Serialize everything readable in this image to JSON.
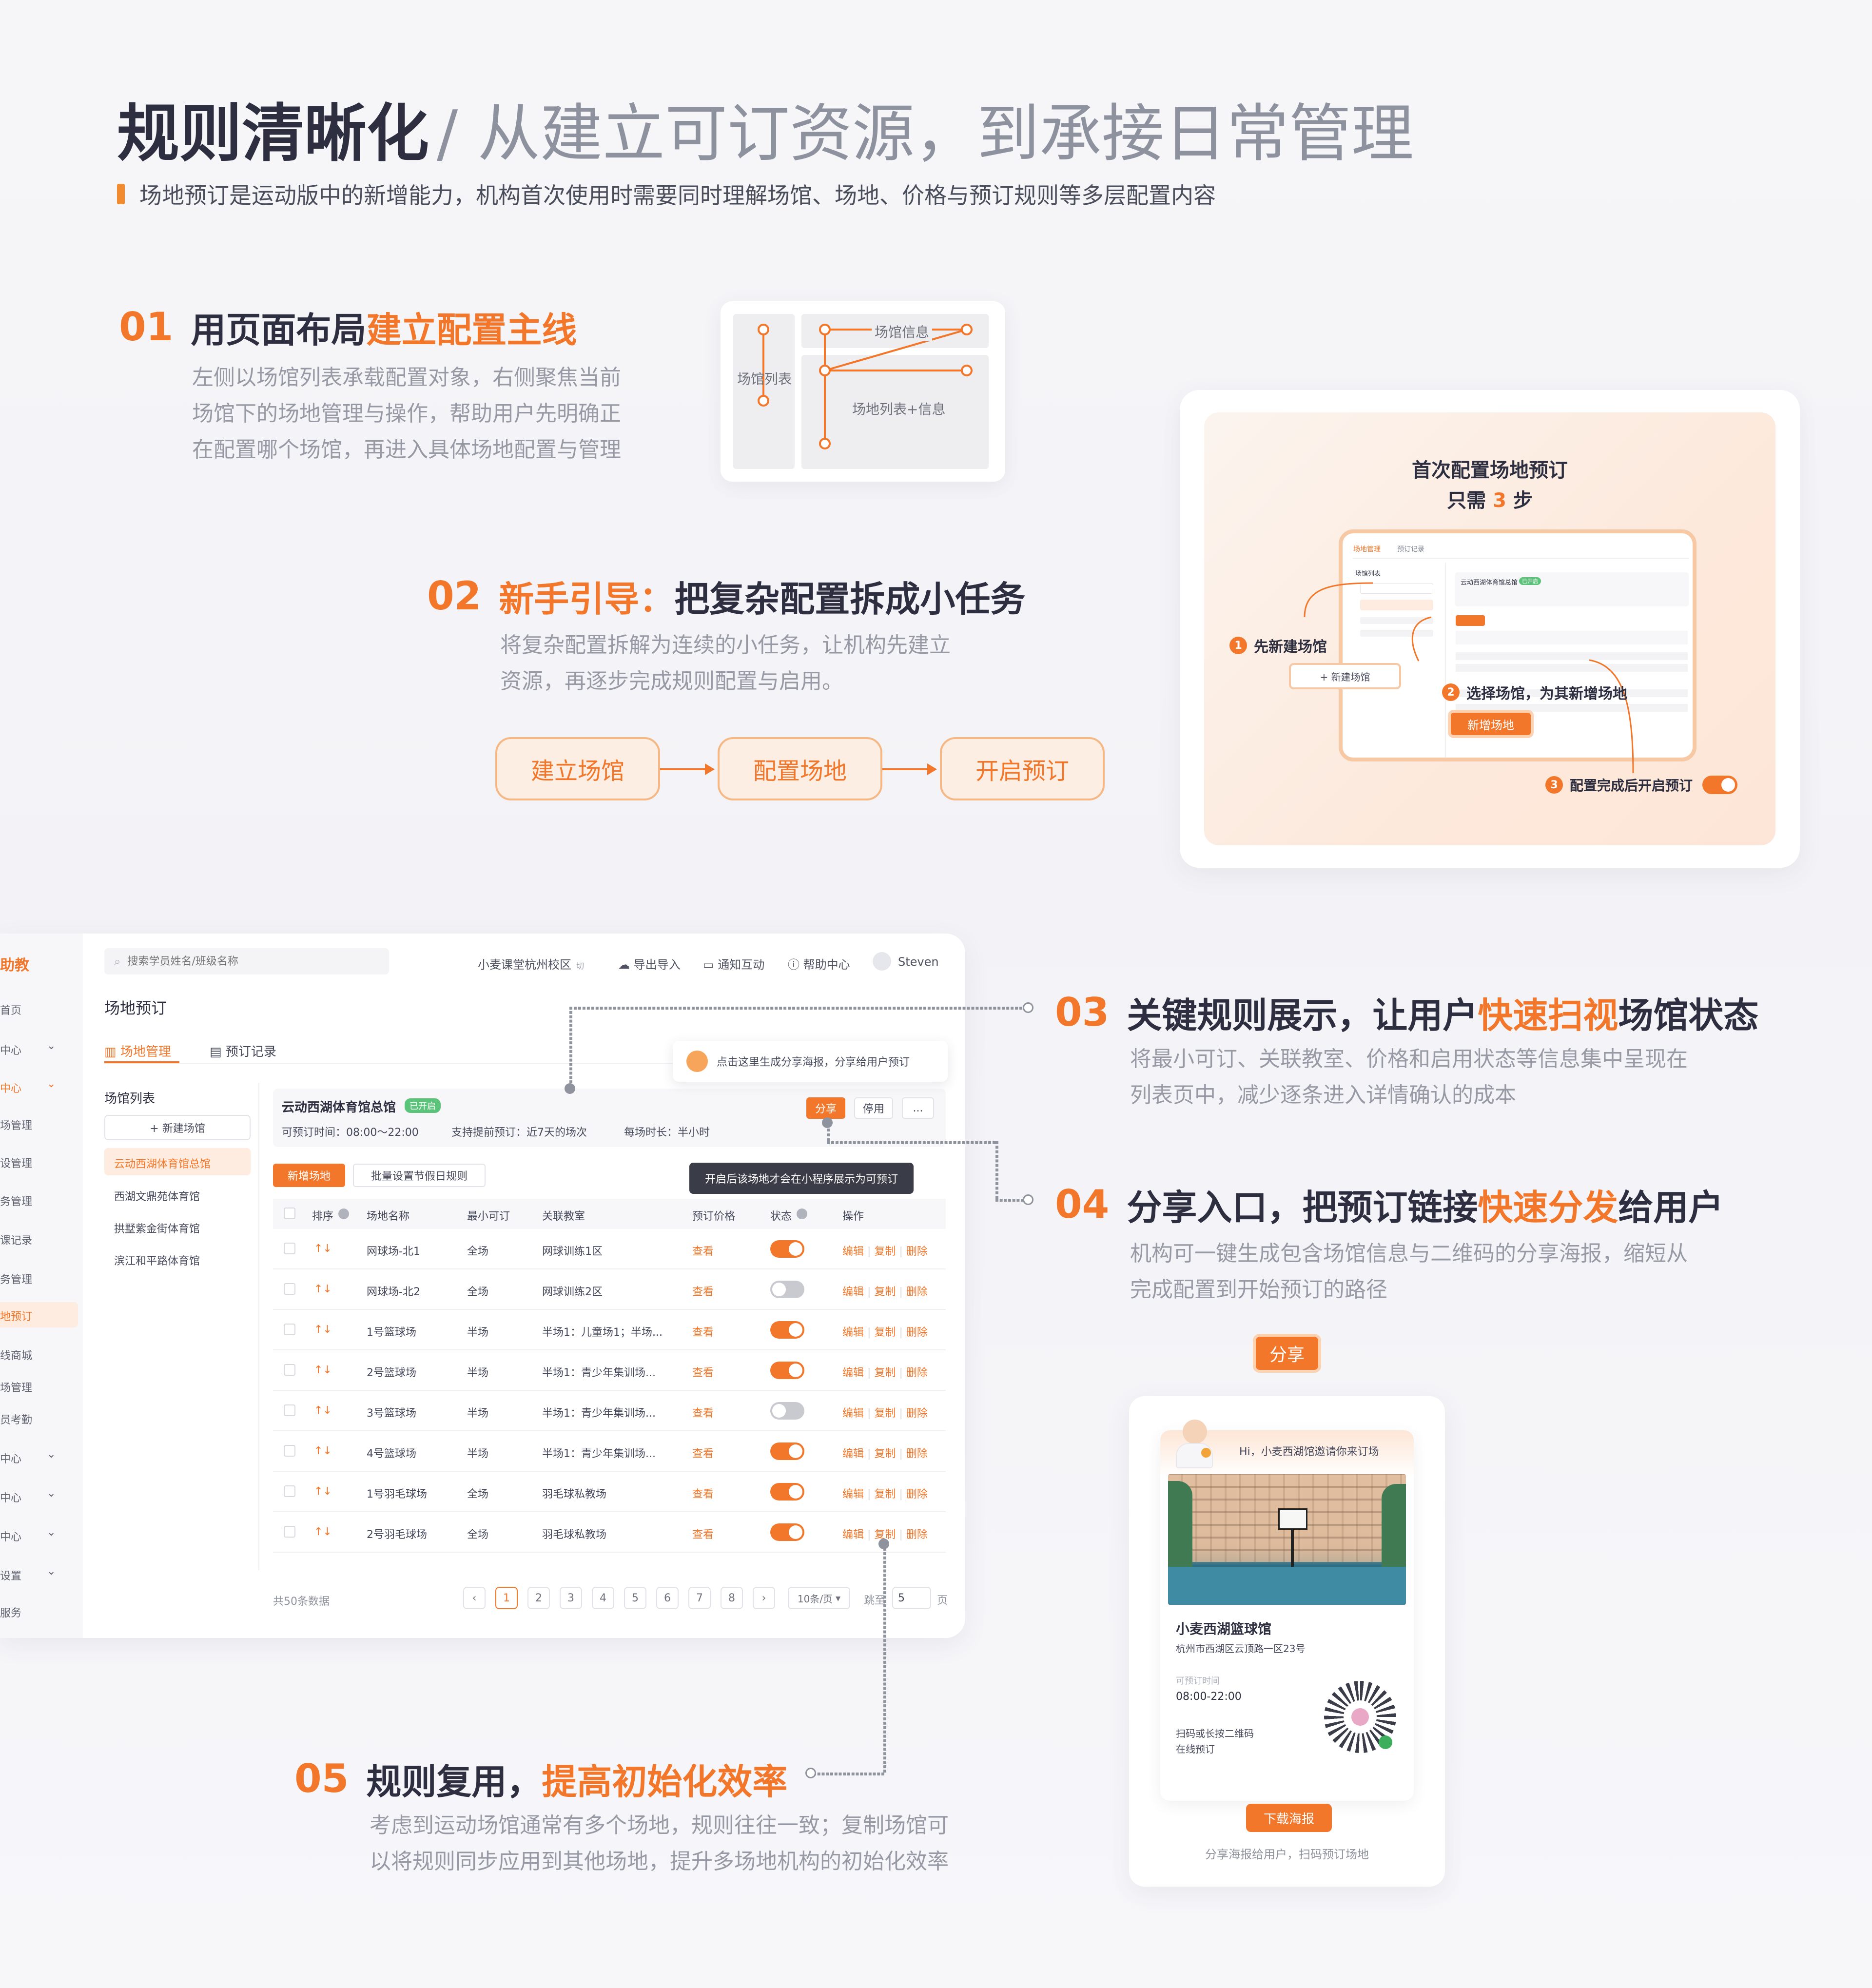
{
  "header": {
    "title_main": "规则清晰化",
    "title_sub": "/ 从建立可订资源，到承接日常管理",
    "desc": "场地预订是运动版中的新增能力，机构首次使用时需要同时理解场馆、场地、价格与预订规则等多层配置内容"
  },
  "s1": {
    "num": "01",
    "title_a": "用页面布局",
    "title_b": "建立配置主线",
    "desc": [
      "左侧以场馆列表承载配置对象，右侧聚焦当前",
      "场馆下的场地管理与操作，帮助用户先明确正",
      "在配置哪个场馆，再进入具体场地配置与管理"
    ],
    "diag": {
      "left": "场馆列表",
      "top": "场馆信息",
      "bottom": "场地列表+信息"
    }
  },
  "s2": {
    "num": "02",
    "title_a": "新手引导：",
    "title_b": "把复杂配置拆成小任务",
    "desc": [
      "将复杂配置拆解为连续的小任务，让机构先建立",
      "资源，再逐步完成规则配置与启用。"
    ],
    "steps": [
      "建立场馆",
      "配置场地",
      "开启预订"
    ]
  },
  "guide": {
    "title1": "首次配置场地预订",
    "title2a": "只需 ",
    "title2b": "3",
    "title2c": " 步",
    "step1": "先新建场馆",
    "step2": "选择场馆，为其新增场地",
    "step3": "配置完成后开启预订",
    "btn_new_venue": "+ 新建场馆",
    "btn_new_court": "新增场地",
    "mini_tab1": "场地管理",
    "mini_tab2": "预订记录",
    "mini_list": "场馆列表",
    "mini_venue": "云动西湖体育馆总馆",
    "mini_badge": "已开启",
    "n1": "1",
    "n2": "2",
    "n3": "3"
  },
  "s3": {
    "num": "03",
    "title_a": "关键规则展示，让用户",
    "title_b": "快速扫视",
    "title_c": "场馆状态",
    "desc": [
      "将最小可订、关联教室、价格和启用状态等信息集中呈现在",
      "列表页中，减少逐条进入详情确认的成本"
    ]
  },
  "s4": {
    "num": "04",
    "title_a": "分享入口，把预订链接",
    "title_b": "快速分发",
    "title_c": "给用户",
    "desc": [
      "机构可一键生成包含场馆信息与二维码的分享海报，缩短从",
      "完成配置到开始预订的路径"
    ]
  },
  "s5": {
    "num": "05",
    "title_a": "规则复用，",
    "title_b": "提高初始化效率",
    "desc": [
      "考虑到运动场馆通常有多个场地，规则往往一致；复制场馆可",
      "以将规则同步应用到其他场地，提升多场地机构的初始化效率"
    ]
  },
  "app": {
    "brand": "助教",
    "search_placeholder": "搜索学员姓名/班级名称",
    "campus": "小麦课堂杭州校区",
    "campus_tag": "切",
    "top_actions": [
      "导出导入",
      "通知互动",
      "帮助中心"
    ],
    "user": "Steven",
    "side": [
      "首页",
      "中心",
      "中心",
      "场管理",
      "设管理",
      "务管理",
      "课记录",
      "务管理",
      "地预订",
      "线商城",
      "场管理",
      "员考勤",
      "中心",
      "中心",
      "中心",
      "设置",
      "服务"
    ],
    "page_title": "场地预订",
    "tab1": "场地管理",
    "tab2": "预订记录",
    "list_title": "场馆列表",
    "new_venue": "+ 新建场馆",
    "venues": [
      "云动西湖体育馆总馆",
      "西湖文鼎苑体育馆",
      "拱墅紫金街体育馆",
      "滨江和平路体育馆"
    ],
    "venue_name": "云动西湖体育馆总馆",
    "venue_badge": "已开启",
    "rule1": "可预订时间：08:00～22:00",
    "rule2": "支持提前预订：近7天的场次",
    "rule3": "每场时长：半小时",
    "btn_share": "分享",
    "btn_disable": "停用",
    "btn_more": "...",
    "share_tip": "点击这里生成分享海报，分享给用户预订",
    "btn_add": "新增场地",
    "btn_batch": "批量设置节假日规则",
    "status_tip": "开启后该场地才会在小程序展示为可预订",
    "cols": [
      "排序",
      "场地名称",
      "最小可订",
      "关联教室",
      "预订价格",
      "状态",
      "操作"
    ],
    "rows": [
      {
        "name": "网球场-北1",
        "min": "全场",
        "room": "网球训练1区",
        "price": "查看",
        "on": true
      },
      {
        "name": "网球场-北2",
        "min": "全场",
        "room": "网球训练2区",
        "price": "查看",
        "on": false
      },
      {
        "name": "1号篮球场",
        "min": "半场",
        "room": "半场1：儿童场1；半场...",
        "price": "查看",
        "on": true
      },
      {
        "name": "2号篮球场",
        "min": "半场",
        "room": "半场1：青少年集训场...",
        "price": "查看",
        "on": true
      },
      {
        "name": "3号篮球场",
        "min": "半场",
        "room": "半场1：青少年集训场...",
        "price": "查看",
        "on": false
      },
      {
        "name": "4号篮球场",
        "min": "半场",
        "room": "半场1：青少年集训场...",
        "price": "查看",
        "on": true
      },
      {
        "name": "1号羽毛球场",
        "min": "全场",
        "room": "羽毛球私教场",
        "price": "查看",
        "on": true
      },
      {
        "name": "2号羽毛球场",
        "min": "全场",
        "room": "羽毛球私教场",
        "price": "查看",
        "on": true
      }
    ],
    "sort_arrows": "↑↓",
    "ops": {
      "edit": "编辑",
      "copy": "复制",
      "del": "删除",
      "sep": "|"
    },
    "total": "共50条数据",
    "pages": [
      "‹",
      "1",
      "2",
      "3",
      "4",
      "5",
      "6",
      "7",
      "8",
      "›"
    ],
    "page_size": "10条/页",
    "jump": "跳至",
    "jump_val": "5",
    "page_unit": "页"
  },
  "share": {
    "tag": "分享",
    "greet": "Hi，小麦西湖馆邀请你来订场",
    "venue": "小麦西湖篮球馆",
    "addr": "杭州市西湖区云顶路一区23号",
    "time_label": "可预订时间",
    "time": "08:00-22:00",
    "scan1": "扫码或长按二维码",
    "scan2": "在线预订",
    "download": "下载海报",
    "foot": "分享海报给用户，扫码预订场地"
  },
  "colors": {
    "accent": "#f2772a",
    "title": "#2d2f40",
    "muted": "#8f939e"
  }
}
